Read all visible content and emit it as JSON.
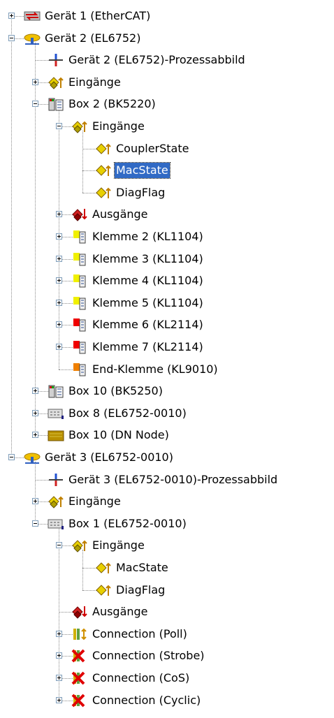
{
  "tree": {
    "selected_label": "MacState",
    "nodes": [
      {
        "label": "Gerät 1 (EtherCAT)",
        "level": 0,
        "toggle": "plus",
        "icon": "ethercat-device-icon"
      },
      {
        "label": "Gerät 2 (EL6752)",
        "level": 0,
        "toggle": "minus",
        "icon": "devicenet-device-icon"
      },
      {
        "label": "Gerät 2 (EL6752)-Prozessabbild",
        "level": 1,
        "toggle": "none",
        "icon": "process-image-icon"
      },
      {
        "label": "Eingänge",
        "level": 1,
        "toggle": "plus",
        "icon": "inputs-icon"
      },
      {
        "label": "Box 2  (BK5220)",
        "level": 1,
        "toggle": "minus",
        "icon": "bus-coupler-icon"
      },
      {
        "label": "Eingänge",
        "level": 2,
        "toggle": "minus",
        "icon": "inputs-icon"
      },
      {
        "label": "CouplerState",
        "level": 3,
        "toggle": "none",
        "icon": "input-variable-icon"
      },
      {
        "label": "MacState",
        "level": 3,
        "toggle": "none",
        "icon": "input-variable-icon"
      },
      {
        "label": "DiagFlag",
        "level": 3,
        "toggle": "none",
        "icon": "input-variable-icon"
      },
      {
        "label": "Ausgänge",
        "level": 2,
        "toggle": "plus",
        "icon": "outputs-icon"
      },
      {
        "label": "Klemme 2 (KL1104)",
        "level": 2,
        "toggle": "plus",
        "icon": "terminal-yellow-icon"
      },
      {
        "label": "Klemme 3 (KL1104)",
        "level": 2,
        "toggle": "plus",
        "icon": "terminal-yellow-icon"
      },
      {
        "label": "Klemme 4 (KL1104)",
        "level": 2,
        "toggle": "plus",
        "icon": "terminal-yellow-icon"
      },
      {
        "label": "Klemme 5 (KL1104)",
        "level": 2,
        "toggle": "plus",
        "icon": "terminal-yellow-icon"
      },
      {
        "label": "Klemme 6 (KL2114)",
        "level": 2,
        "toggle": "plus",
        "icon": "terminal-red-icon"
      },
      {
        "label": "Klemme 7 (KL2114)",
        "level": 2,
        "toggle": "plus",
        "icon": "terminal-red-icon"
      },
      {
        "label": "End-Klemme (KL9010)",
        "level": 2,
        "toggle": "none",
        "icon": "terminal-orange-icon"
      },
      {
        "label": "Box 10  (BK5250)",
        "level": 1,
        "toggle": "plus",
        "icon": "bus-coupler-icon"
      },
      {
        "label": "Box 8 (EL6752-0010)",
        "level": 1,
        "toggle": "plus",
        "icon": "slave-box-icon"
      },
      {
        "label": "Box 10 (DN Node)",
        "level": 1,
        "toggle": "plus",
        "icon": "dn-node-icon"
      },
      {
        "label": "Gerät 3 (EL6752-0010)",
        "level": 0,
        "toggle": "minus",
        "icon": "devicenet-device-icon"
      },
      {
        "label": "Gerät 3 (EL6752-0010)-Prozessabbild",
        "level": 1,
        "toggle": "none",
        "icon": "process-image-icon"
      },
      {
        "label": "Eingänge",
        "level": 1,
        "toggle": "plus",
        "icon": "inputs-icon"
      },
      {
        "label": "Box 1 (EL6752-0010)",
        "level": 1,
        "toggle": "minus",
        "icon": "slave-box-icon"
      },
      {
        "label": "Eingänge",
        "level": 2,
        "toggle": "minus",
        "icon": "inputs-icon"
      },
      {
        "label": "MacState",
        "level": 3,
        "toggle": "none",
        "icon": "input-variable-icon"
      },
      {
        "label": "DiagFlag",
        "level": 3,
        "toggle": "none",
        "icon": "input-variable-icon"
      },
      {
        "label": "Ausgänge",
        "level": 2,
        "toggle": "none",
        "icon": "outputs-icon"
      },
      {
        "label": "Connection (Poll)",
        "level": 2,
        "toggle": "plus",
        "icon": "connection-active-icon"
      },
      {
        "label": "Connection (Strobe)",
        "level": 2,
        "toggle": "plus",
        "icon": "connection-disabled-icon"
      },
      {
        "label": "Connection (CoS)",
        "level": 2,
        "toggle": "plus",
        "icon": "connection-disabled-icon"
      },
      {
        "label": "Connection (Cyclic)",
        "level": 2,
        "toggle": "plus",
        "icon": "connection-disabled-icon"
      }
    ]
  }
}
